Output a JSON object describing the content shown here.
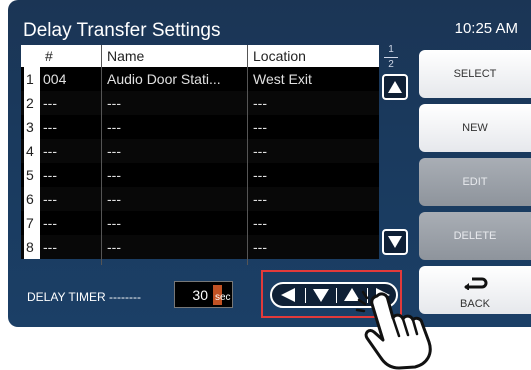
{
  "screen": {
    "title": "Delay Transfer Settings",
    "time": "10:25 AM"
  },
  "table": {
    "headers": [
      "#",
      "Name",
      "Location"
    ],
    "rows": [
      {
        "index": "1",
        "number": "004",
        "name": "Audio Door Stati...",
        "location": "West Exit"
      },
      {
        "index": "2",
        "number": "---",
        "name": "---",
        "location": "---"
      },
      {
        "index": "3",
        "number": "---",
        "name": "---",
        "location": "---"
      },
      {
        "index": "4",
        "number": "---",
        "name": "---",
        "location": "---"
      },
      {
        "index": "5",
        "number": "---",
        "name": "---",
        "location": "---"
      },
      {
        "index": "6",
        "number": "---",
        "name": "---",
        "location": "---"
      },
      {
        "index": "7",
        "number": "---",
        "name": "---",
        "location": "---"
      },
      {
        "index": "8",
        "number": "---",
        "name": "---",
        "location": "---"
      }
    ]
  },
  "pager": {
    "current": "1",
    "total": "2"
  },
  "actions": {
    "select": "SELECT",
    "new": "NEW",
    "edit": "EDIT",
    "delete": "DELETE",
    "back": "BACK"
  },
  "timer": {
    "label": "DELAY TIMER --------",
    "value": "30",
    "unit": "sec"
  },
  "colors": {
    "panel_bg": "#1b3a5e",
    "highlight": "#e23a3a",
    "timer_cursor": "#e4602a"
  },
  "icons": [
    "scroll-up-icon",
    "scroll-down-icon",
    "left-arrow-icon",
    "down-arrow-icon",
    "up-arrow-icon",
    "right-arrow-icon",
    "back-arrow-icon",
    "pointing-hand-icon"
  ]
}
